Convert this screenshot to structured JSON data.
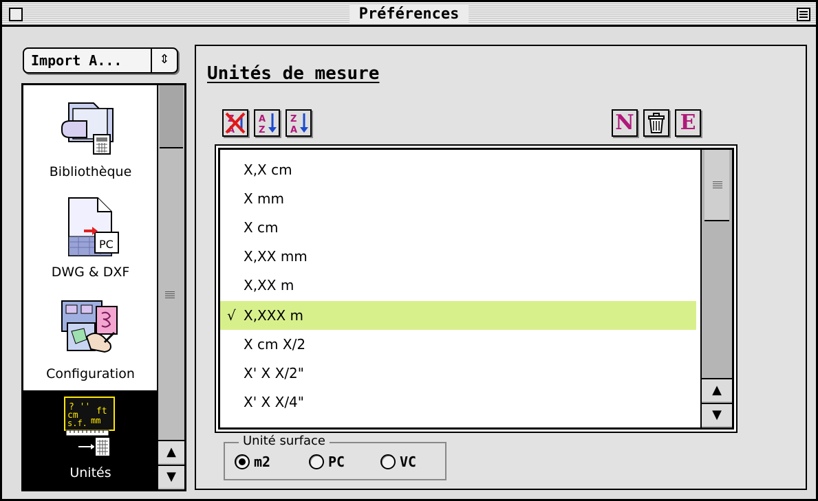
{
  "window": {
    "title": "Préférences"
  },
  "sidebar": {
    "popup_label": "Import A...",
    "items": [
      {
        "label": "Bibliothèque",
        "icon": "library-folder-icon"
      },
      {
        "label": "DWG & DXF",
        "icon": "dwg-dxf-document-icon"
      },
      {
        "label": "Configuration",
        "icon": "configuration-icon"
      },
      {
        "label": "Unités",
        "icon": "units-icon",
        "selected": true
      }
    ]
  },
  "main": {
    "title": "Unités de mesure",
    "toolbar": {
      "delete_sort": "delete-sort-icon",
      "sort_az": "sort-az-icon",
      "sort_za": "sort-za-icon",
      "new_label": "N",
      "trash": "trash-icon",
      "edit_label": "E"
    },
    "units": [
      {
        "label": "X,X cm"
      },
      {
        "label": "X mm"
      },
      {
        "label": "X cm"
      },
      {
        "label": "X,XX mm"
      },
      {
        "label": "X,XX m"
      },
      {
        "label": "X,XXX m",
        "selected": true,
        "check": "√"
      },
      {
        "label": "X cm X/2"
      },
      {
        "label": "X' X X/2\""
      },
      {
        "label": "X' X X/4\""
      }
    ],
    "surface": {
      "title": "Unité surface",
      "options": [
        {
          "label": "m2",
          "selected": true
        },
        {
          "label": "PC",
          "selected": false
        },
        {
          "label": "VC",
          "selected": false
        }
      ]
    }
  },
  "colors": {
    "selection_highlight": "#d8f08c",
    "toolbar_letter": "#b0197a",
    "window_bg": "#dedede"
  }
}
